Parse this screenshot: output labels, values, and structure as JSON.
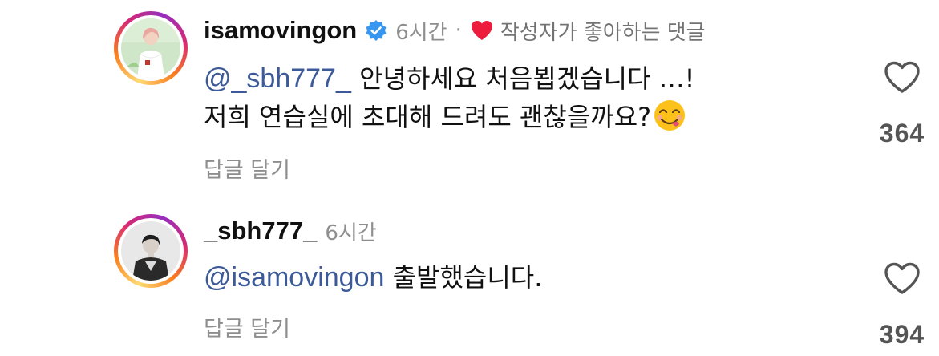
{
  "comments": [
    {
      "username": "isamovingon",
      "verified": true,
      "time": "6시간",
      "separator": "·",
      "liked_by_creator": "작성자가 좋아하는 댓글",
      "mention": "@_sbh777_",
      "text_line1": " 안녕하세요 처음뵙겠습니다 …!",
      "text_line2": "저희 연습실에 초대해 드려도 괜찮을까요?",
      "emoji": "face-savoring-food-emoji",
      "reply_label": "답글 달기",
      "like_count": "364"
    },
    {
      "username": "_sbh777_",
      "verified": false,
      "time": "6시간",
      "mention": "@isamovingon",
      "text_line1": " 출발했습니다.",
      "reply_label": "답글 달기",
      "like_count": "394"
    }
  ],
  "colors": {
    "mention": "#3d5a98",
    "meta": "#8e8e8e",
    "verified": "#3797f0",
    "heart_red": "#ed1c3c"
  },
  "icons": {
    "verified": "verified-badge-icon",
    "liked": "heart-filled-icon",
    "like": "heart-outline-icon"
  }
}
